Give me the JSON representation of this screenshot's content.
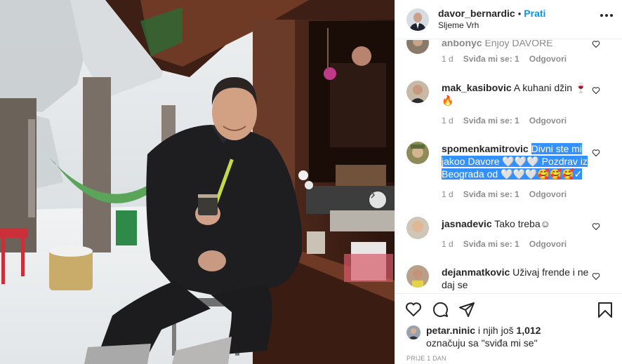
{
  "post": {
    "username": "davor_bernardic",
    "separator": "•",
    "follow_label": "Prati",
    "location": "Sljeme Vrh"
  },
  "comments": [
    {
      "username": "anbonyc",
      "text": "Enjoy DAVORE",
      "time": "1 d",
      "likes": "Sviđa mi se: 1",
      "reply": "Odgovori"
    },
    {
      "username": "mak_kasibovic",
      "text": "A kuhani džin 🍷🔥",
      "time": "1 d",
      "likes": "Sviđa mi se: 1",
      "reply": "Odgovori"
    },
    {
      "username": "spomenkamitrovic",
      "text": "Divni ste mi jakoo Davore 🤍🤍🤍 Pozdrav iz Beograda od 🤍🤍🤍🥰🥰🥰✓",
      "time": "1 d",
      "likes": "Sviđa mi se: 1",
      "reply": "Odgovori"
    },
    {
      "username": "jasnadevic",
      "text": "Tako treba☺",
      "time": "1 d",
      "likes": "Sviđa mi se: 1",
      "reply": "Odgovori"
    },
    {
      "username": "dejanmatkovic",
      "text": "Uživaj frende i ne daj se",
      "time": "",
      "likes": "",
      "reply": ""
    }
  ],
  "likes": {
    "user": "petar.ninic",
    "connector": "i njih još",
    "count": "1,012",
    "suffix": "označuju sa \"sviđa mi se\""
  },
  "date_label": "PRIJE 1 DAN",
  "icons": {
    "like": "heart-icon",
    "comment": "comment-icon",
    "share": "share-icon",
    "save": "bookmark-icon",
    "next": "chevron-right-icon",
    "more": "more-options-icon"
  },
  "colors": {
    "accent": "#0095f6",
    "selection": "#3390ff",
    "meta_gray": "#8e8e8e",
    "text": "#262626"
  }
}
